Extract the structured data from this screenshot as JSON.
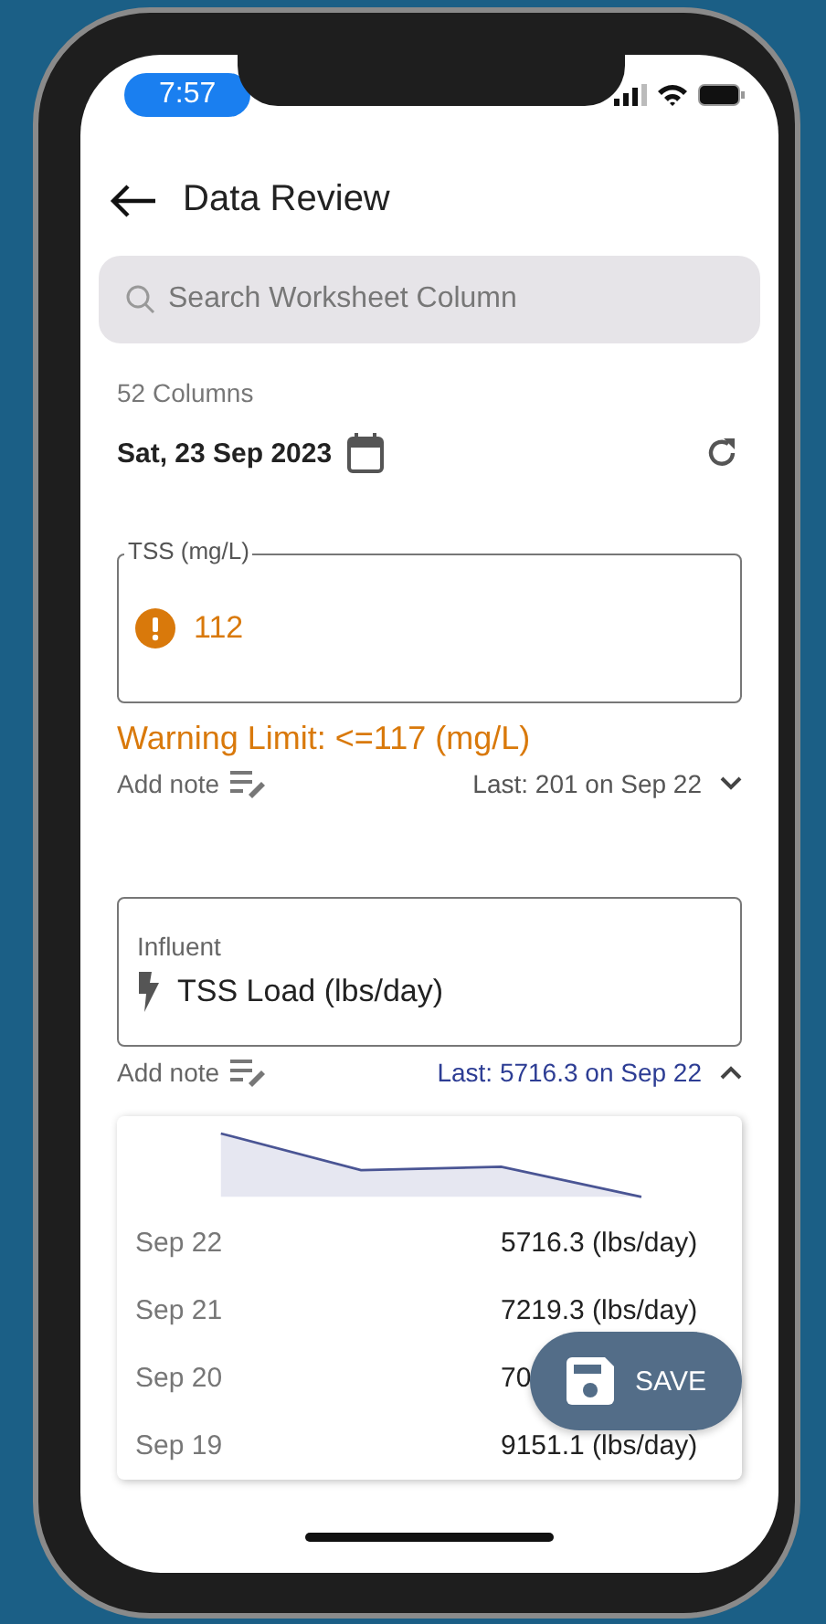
{
  "status_bar": {
    "time": "7:57"
  },
  "header": {
    "title": "Data Review"
  },
  "search": {
    "placeholder": "Search Worksheet Column"
  },
  "column_count": "52 Columns",
  "date": "Sat, 23 Sep 2023",
  "fields": [
    {
      "kind": "reading",
      "label": "TSS (mg/L)",
      "value": "112",
      "warning": true,
      "warning_text": "Warning Limit: <=117 (mg/L)",
      "note_label": "Add note",
      "last": "Last: 201 on Sep 22",
      "expanded": false
    },
    {
      "kind": "column",
      "group": "Influent",
      "name": "TSS Load (lbs/day)",
      "note_label": "Add note",
      "last": "Last: 5716.3 on Sep 22",
      "expanded": true,
      "history": [
        {
          "date": "Sep 22",
          "value": "5716.3 (lbs/day)"
        },
        {
          "date": "Sep 21",
          "value": "7219.3 (lbs/day)"
        },
        {
          "date": "Sep 20",
          "value": "70"
        },
        {
          "date": "Sep 19",
          "value": "9151.1 (lbs/day)"
        }
      ]
    }
  ],
  "save_button": {
    "label": "SAVE"
  }
}
